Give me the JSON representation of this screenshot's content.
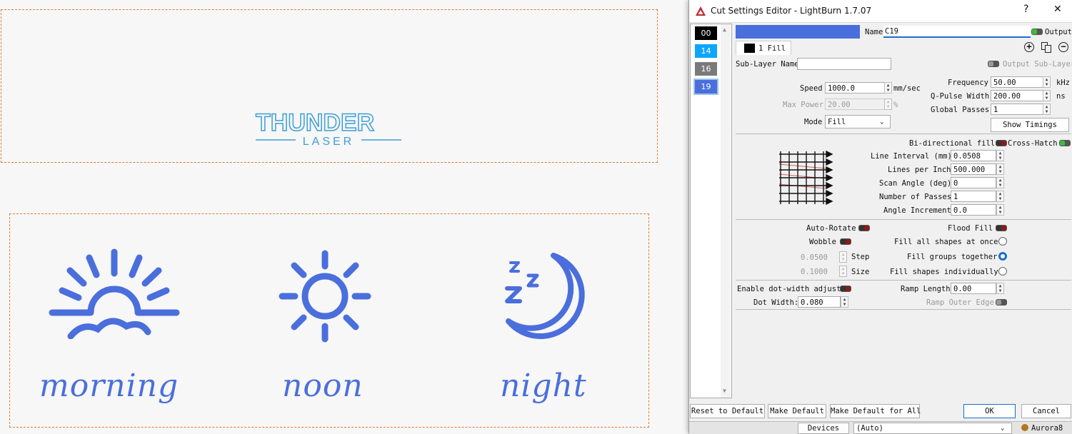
{
  "canvas": {
    "logo": {
      "top": "THUNDER",
      "bottom": "LASER"
    },
    "words": [
      "morning",
      "noon",
      "night"
    ],
    "accent": "#4a6fdc"
  },
  "dialog": {
    "title": "Cut Settings Editor - LightBurn 1.7.07",
    "help": "?",
    "close": "✕",
    "layers": [
      {
        "label": "00",
        "color": "#000000"
      },
      {
        "label": "14",
        "color": "#0ea5ff"
      },
      {
        "label": "16",
        "color": "#7a7a7a"
      },
      {
        "label": "19",
        "color": "#4a6fdc"
      }
    ],
    "layer_color": "#4a6fdc",
    "name_label": "Name",
    "name_value": "C19",
    "output_label": "Output",
    "sublayer_tab": "1 Fill",
    "sublayer_name_label": "Sub-Layer Name",
    "output_sublayer_label": "Output Sub-Layer",
    "speed": {
      "label": "Speed",
      "value": "1000.0",
      "unit": "mm/sec"
    },
    "max_power": {
      "label": "Max Power",
      "value": "20.00",
      "unit": "%"
    },
    "mode": {
      "label": "Mode",
      "value": "Fill"
    },
    "frequency": {
      "label": "Frequency",
      "value": "50.00",
      "unit": "kHz"
    },
    "qpulse": {
      "label": "Q-Pulse Width",
      "value": "200.00",
      "unit": "ns"
    },
    "global_passes": {
      "label": "Global Passes",
      "value": "1"
    },
    "show_timings": "Show Timings",
    "bidir_label": "Bi-directional fill",
    "crosshatch_label": "Cross-Hatch",
    "line_interval": {
      "label": "Line Interval (mm)",
      "value": "0.0508"
    },
    "lpi": {
      "label": "Lines per Inch",
      "value": "500.000"
    },
    "scan_angle": {
      "label": "Scan Angle (deg)",
      "value": "0"
    },
    "num_passes": {
      "label": "Number of Passes",
      "value": "1"
    },
    "angle_inc": {
      "label": "Angle Increment",
      "value": "0.0"
    },
    "auto_rotate": "Auto-Rotate",
    "flood_fill": "Flood Fill",
    "wobble": "Wobble",
    "fill_all": "Fill all shapes at once",
    "fill_groups": "Fill groups together",
    "fill_individual": "Fill shapes individually",
    "step": {
      "value": "0.0500",
      "label": "Step"
    },
    "size": {
      "value": "0.1000",
      "label": "Size"
    },
    "dot_width_adjust": "Enable dot-width adjust",
    "dot_width": {
      "label": "Dot Width:",
      "value": "0.080"
    },
    "ramp_length": {
      "label": "Ramp Length",
      "value": "0.00"
    },
    "ramp_outer": "Ramp Outer Edge",
    "buttons": {
      "reset": "Reset to Default",
      "make_default": "Make Default",
      "make_default_all": "Make Default for All",
      "ok": "OK",
      "cancel": "Cancel"
    },
    "statusbar": {
      "devices": "Devices",
      "port": "(Auto)",
      "machine": "Aurora8"
    }
  }
}
